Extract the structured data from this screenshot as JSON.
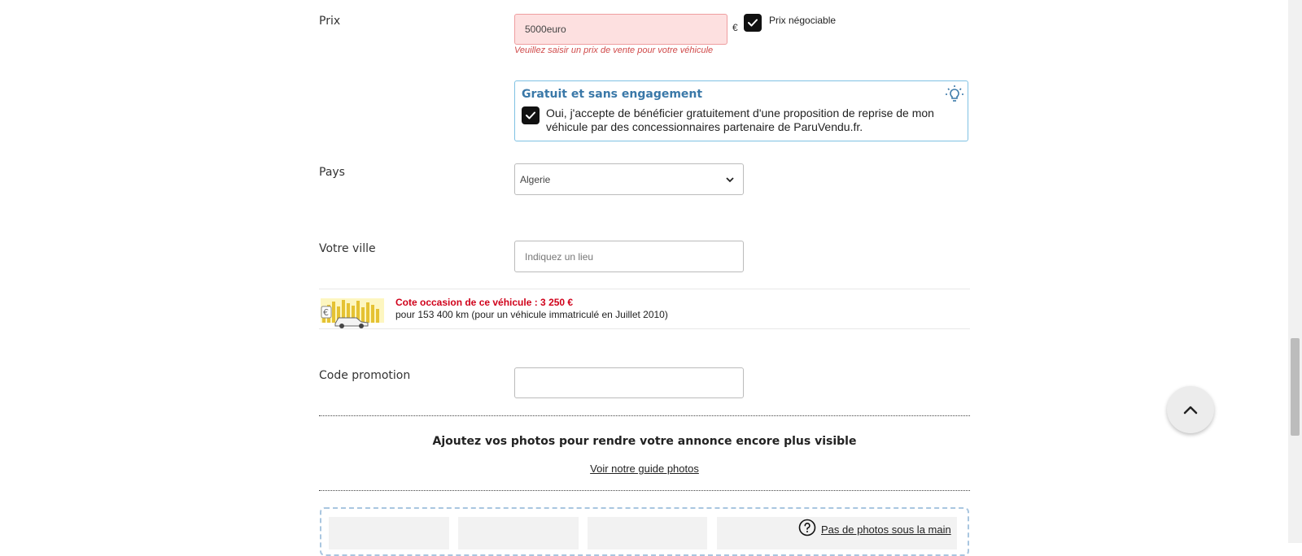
{
  "price": {
    "label": "Prix",
    "value": "5000euro",
    "currency": "€",
    "negotiable_label": "Prix négociable",
    "negotiable_checked": true,
    "error": "Veuillez saisir un prix de vente pour votre véhicule"
  },
  "offer": {
    "title": "Gratuit et sans engagement",
    "line1": "Oui, j'accepte de bénéficier gratuitement d'une proposition de reprise de mon",
    "line2": "véhicule par des concessionnaires partenaire de ParuVendu.fr.",
    "checked": true
  },
  "country": {
    "label": "Pays",
    "selected": "Algerie"
  },
  "city": {
    "label": "Votre ville",
    "placeholder": "Indiquez un lieu"
  },
  "cote": {
    "title": "Cote occasion de ce véhicule : 3 250 €",
    "subtitle": "pour 153 400 km (pour un véhicule immatriculé en Juillet 2010)"
  },
  "promo": {
    "label": "Code promotion",
    "value": ""
  },
  "photos": {
    "title": "Ajoutez vos photos pour rendre votre annonce encore plus visible",
    "guide_link": "Voir notre guide photos",
    "no_photos_link": "Pas de photos sous la main"
  },
  "colors": {
    "error_bg": "#fde0e0",
    "error_text": "#d04a4a",
    "offer_border": "#7fc1e3",
    "offer_title": "#3a78a8",
    "cote_title": "#d0021b"
  }
}
